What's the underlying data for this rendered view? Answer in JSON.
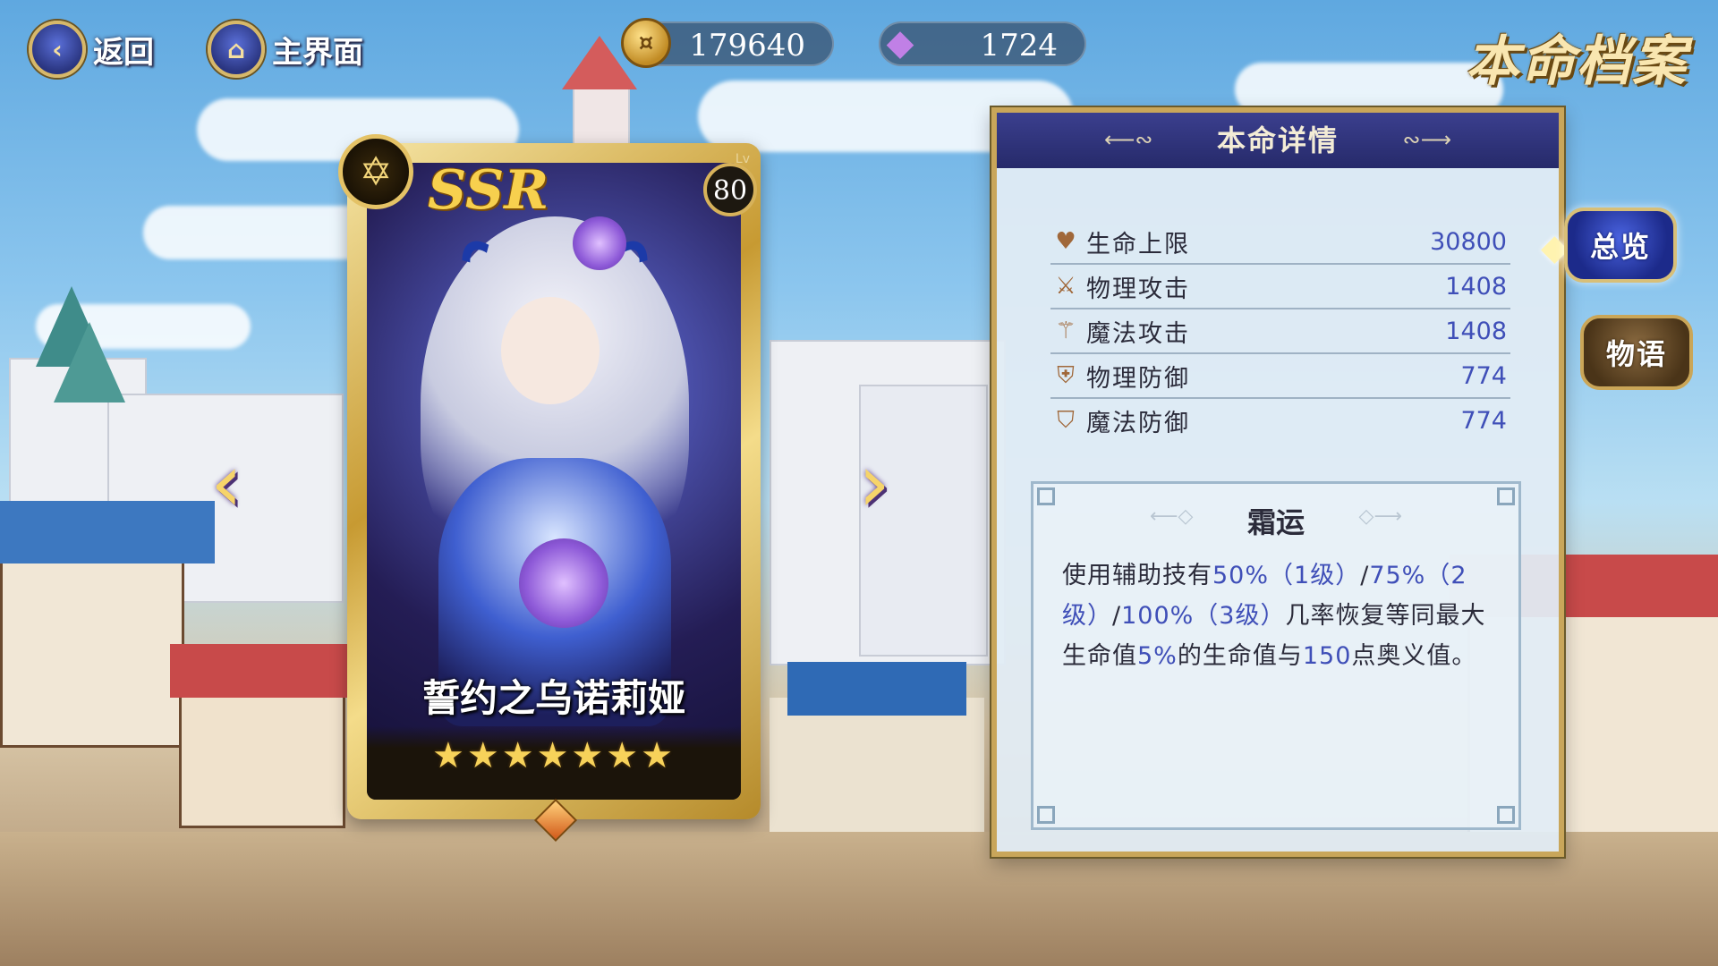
{
  "top_bar": {
    "back_label": "返回",
    "home_label": "主界面",
    "gold": "179640",
    "gems": "1724",
    "page_title": "本命档案"
  },
  "card": {
    "rarity": "SSR",
    "level_prefix": "Lv",
    "level": "80",
    "name": "誓约之乌诺莉娅",
    "stars": "★★★★★★★"
  },
  "panel": {
    "title": "本命详情",
    "stats": [
      {
        "icon": "heart-icon",
        "glyph": "♥",
        "name": "生命上限",
        "value": "30800"
      },
      {
        "icon": "sword-icon",
        "glyph": "⚔",
        "name": "物理攻击",
        "value": "1408"
      },
      {
        "icon": "staff-icon",
        "glyph": "⚚",
        "name": "魔法攻击",
        "value": "1408"
      },
      {
        "icon": "shield-icon",
        "glyph": "⛨",
        "name": "物理防御",
        "value": "774"
      },
      {
        "icon": "magic-shield-icon",
        "glyph": "⛉",
        "name": "魔法防御",
        "value": "774"
      }
    ],
    "skill": {
      "title": "霜运",
      "desc_parts": [
        {
          "t": "使用辅助技有",
          "hl": false
        },
        {
          "t": "50%（1级）",
          "hl": true
        },
        {
          "t": "/",
          "hl": false
        },
        {
          "t": "75%（2级）",
          "hl": true
        },
        {
          "t": "/",
          "hl": false
        },
        {
          "t": "100%（3级）",
          "hl": true
        },
        {
          "t": "几率恢复等同最大生命值",
          "hl": false
        },
        {
          "t": "5%",
          "hl": true
        },
        {
          "t": "的生命值与",
          "hl": false
        },
        {
          "t": "150",
          "hl": true
        },
        {
          "t": "点奥义值。",
          "hl": false
        }
      ]
    }
  },
  "side_tabs": {
    "overview": "总览",
    "story": "物语"
  }
}
